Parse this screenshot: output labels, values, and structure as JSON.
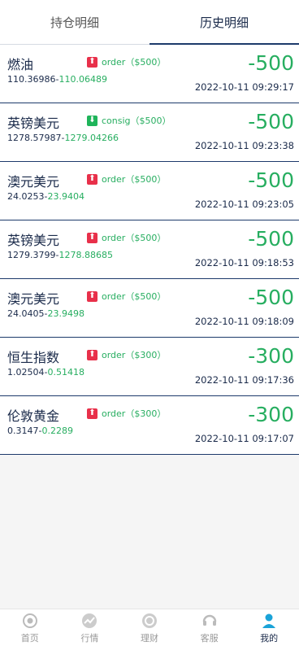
{
  "tabs": [
    {
      "label": "持仓明细",
      "active": false
    },
    {
      "label": "历史明细",
      "active": true
    }
  ],
  "records": [
    {
      "name": "燃油",
      "direction": "up",
      "badge": "order（$500）",
      "open_price": "110.36986",
      "close_price": "110.06489",
      "amount": "-500",
      "time": "2022-10-11 09:29:17"
    },
    {
      "name": "英镑美元",
      "direction": "down",
      "badge": "consig（$500）",
      "open_price": "1278.57987",
      "close_price": "1279.04266",
      "amount": "-500",
      "time": "2022-10-11 09:23:38"
    },
    {
      "name": "澳元美元",
      "direction": "up",
      "badge": "order（$500）",
      "open_price": "24.0253",
      "close_price": "23.9404",
      "amount": "-500",
      "time": "2022-10-11 09:23:05"
    },
    {
      "name": "英镑美元",
      "direction": "up",
      "badge": "order（$500）",
      "open_price": "1279.3799",
      "close_price": "1278.88685",
      "amount": "-500",
      "time": "2022-10-11 09:18:53"
    },
    {
      "name": "澳元美元",
      "direction": "up",
      "badge": "order（$500）",
      "open_price": "24.0405",
      "close_price": "23.9498",
      "amount": "-500",
      "time": "2022-10-11 09:18:09"
    },
    {
      "name": "恒生指数",
      "direction": "up",
      "badge": "order（$300）",
      "open_price": "1.02504",
      "close_price": "0.51418",
      "amount": "-300",
      "time": "2022-10-11 09:17:36"
    },
    {
      "name": "伦敦黄金",
      "direction": "up",
      "badge": "order（$300）",
      "open_price": "0.3147",
      "close_price": "0.2289",
      "amount": "-300",
      "time": "2022-10-11 09:17:07"
    }
  ],
  "price_separator": "-",
  "bottom_nav": [
    {
      "label": "首页",
      "icon": "home-icon",
      "active": false
    },
    {
      "label": "行情",
      "icon": "market-icon",
      "active": false
    },
    {
      "label": "理财",
      "icon": "finance-icon",
      "active": false
    },
    {
      "label": "客服",
      "icon": "service-icon",
      "active": false
    },
    {
      "label": "我的",
      "icon": "profile-icon",
      "active": true
    }
  ],
  "colors": {
    "accent": "#1d3a6b",
    "gain": "#27ae60",
    "up_badge": "#e8304a",
    "down_badge": "#1fb45a"
  }
}
